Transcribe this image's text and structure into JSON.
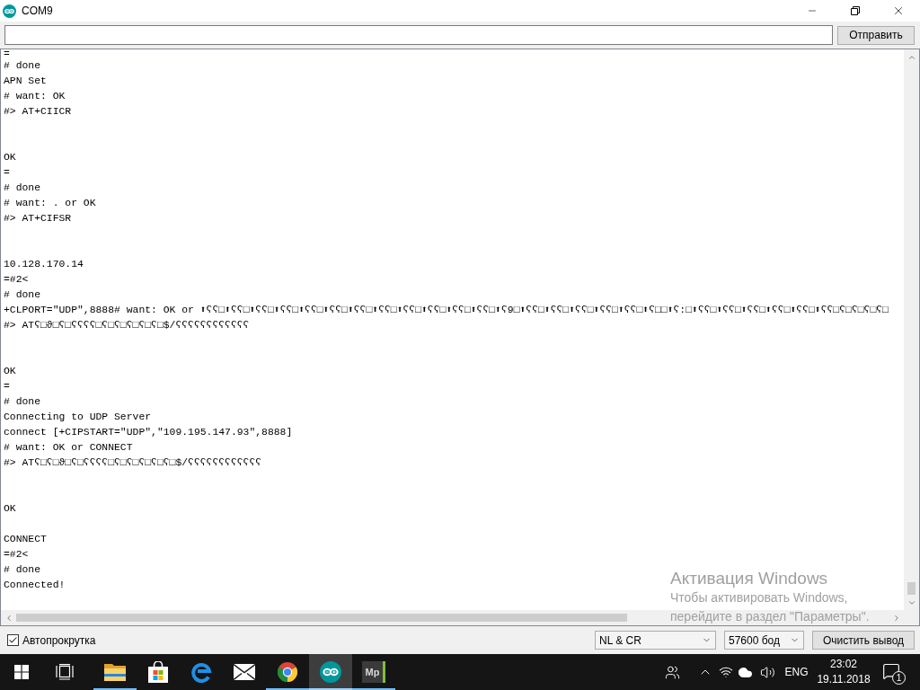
{
  "window": {
    "title": "COM9"
  },
  "send_bar": {
    "send_button": "Отправить"
  },
  "output": {
    "lines": [
      {
        "kind": "text",
        "text": "="
      },
      {
        "kind": "text",
        "text": "# done"
      },
      {
        "kind": "text",
        "text": "APN Set"
      },
      {
        "kind": "text",
        "text": "# want: OK"
      },
      {
        "kind": "text",
        "text": "#> AT+CIICR"
      },
      {
        "kind": "blank"
      },
      {
        "kind": "blank"
      },
      {
        "kind": "text",
        "text": "OK"
      },
      {
        "kind": "text",
        "text": "="
      },
      {
        "kind": "text",
        "text": "# done"
      },
      {
        "kind": "text",
        "text": "# want: . or OK"
      },
      {
        "kind": "text",
        "text": "#> AT+CIFSR"
      },
      {
        "kind": "blank"
      },
      {
        "kind": "blank"
      },
      {
        "kind": "text",
        "text": "10.128.170.14"
      },
      {
        "kind": "text",
        "text": "=#2<"
      },
      {
        "kind": "text",
        "text": "# done"
      },
      {
        "kind": "text",
        "text": "+CLPORT=\"UDP\",8888# want: OK or ⬆ʕʕ□⬆ʕʕ□⬆ʕʕ□⬆ʕʕ□⬆ʕʕ□⬆ʕʕ□⬆ʕʕ□⬆ʕʕ□⬆ʕʕ□⬆ʕʕ□⬆ʕʕ□⬆ʕʕ□⬆ʕ9□⬆ʕʕ□⬆ʕʕ□⬆ʕʕ□⬆ʕʕ□⬆ʕʕ□⬆ʕ□□⬆ʕ:□⬆ʕʕ□⬆ʕʕ□⬆ʕʕ□⬆ʕʕ□⬆ʕʕ□⬆ʕʕ□ʕ□ʕ□ʕ□ʕ□"
      },
      {
        "kind": "text",
        "text": "#> ATʕ□ϑ□ʕ□ʕʕʕʕ□ʕ□ʕ□ʕ□ʕ□ʕ□$/ʕʕʕʕʕʕʕʕʕʕʕʕ"
      },
      {
        "kind": "blank"
      },
      {
        "kind": "blank"
      },
      {
        "kind": "text",
        "text": "OK"
      },
      {
        "kind": "text",
        "text": "="
      },
      {
        "kind": "text",
        "text": "# done"
      },
      {
        "kind": "text",
        "text": "Connecting to UDP Server"
      },
      {
        "kind": "text",
        "text": "connect [+CIPSTART=\"UDP\",\"109.195.147.93\",8888]"
      },
      {
        "kind": "text",
        "text": "# want: OK or CONNECT"
      },
      {
        "kind": "text",
        "text": "#> ATʕ□ʕ□ϑ□ʕ□ʕʕʕʕ□ʕ□ʕ□ʕ□ʕ□ʕ□$/ʕʕʕʕʕʕʕʕʕʕʕʕ"
      },
      {
        "kind": "blank"
      },
      {
        "kind": "blank"
      },
      {
        "kind": "text",
        "text": "OK"
      },
      {
        "kind": "blank"
      },
      {
        "kind": "text",
        "text": "CONNECT"
      },
      {
        "kind": "text",
        "text": "=#2<"
      },
      {
        "kind": "text",
        "text": "# done"
      },
      {
        "kind": "text",
        "text": "Connected!"
      }
    ]
  },
  "bottom_bar": {
    "autoscroll": {
      "label": "Автопрокрутка",
      "checked": true
    },
    "line_ending": "NL & CR",
    "baud_rate": "57600 бод",
    "clear_button": "Очистить вывод"
  },
  "taskbar": {
    "apps": [
      {
        "kind": "folder",
        "running": true,
        "selected": false
      },
      {
        "kind": "bag",
        "running": false,
        "selected": false
      },
      {
        "kind": "swirl",
        "running": false,
        "selected": false
      },
      {
        "kind": "envelope",
        "running": false,
        "selected": false
      },
      {
        "kind": "wheel",
        "running": true,
        "selected": false
      },
      {
        "kind": "infinity",
        "running": true,
        "selected": true
      },
      {
        "kind": "tile",
        "label": "Mp",
        "running": true,
        "selected": false
      }
    ],
    "language": "ENG",
    "time": "23:02",
    "date": "19.11.2018",
    "notification_count": "1"
  },
  "activation_notice": {
    "title": "Активация Windows",
    "lines": [
      "Чтобы активировать Windows,",
      "перейдите в раздел \"Параметры\"."
    ]
  }
}
